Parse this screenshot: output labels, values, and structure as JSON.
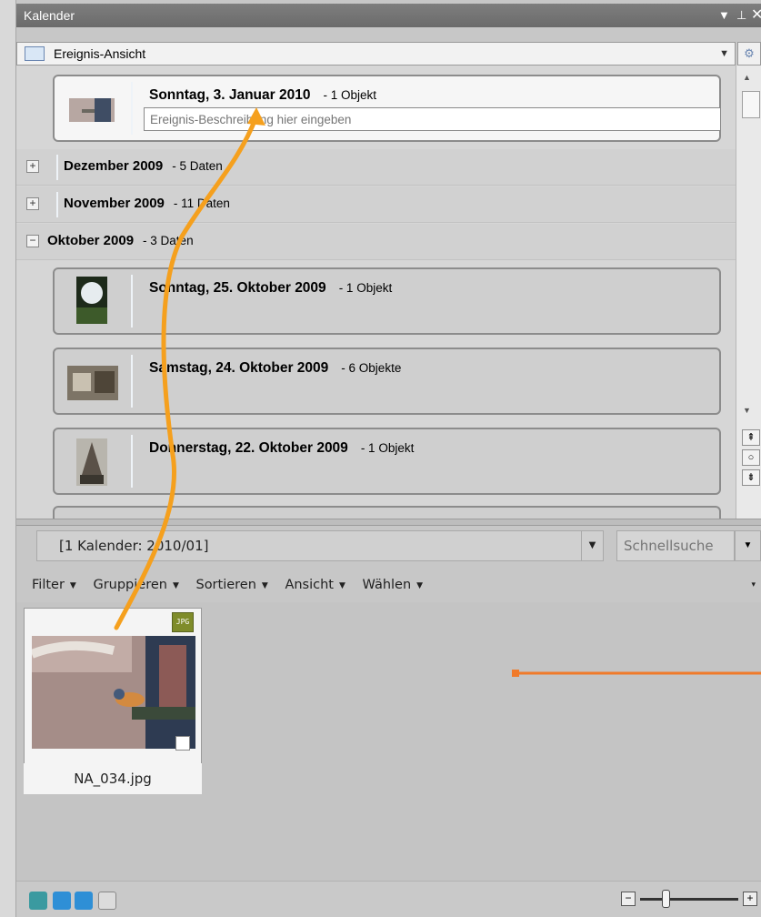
{
  "window": {
    "title": "Kalender"
  },
  "view_selector": {
    "label": "Ereignis-Ansicht"
  },
  "selected_event": {
    "day": "Sonntag, 3. Januar 2010",
    "count": "- 1 Objekt",
    "description_placeholder": "Ereignis-Beschreibung hier eingeben"
  },
  "groups": [
    {
      "month": "Dezember 2009",
      "count": "- 5 Daten",
      "expanded": false
    },
    {
      "month": "November 2009",
      "count": "- 11 Daten",
      "expanded": false
    },
    {
      "month": "Oktober 2009",
      "count": "- 3 Daten",
      "expanded": true
    }
  ],
  "october_events": [
    {
      "day": "Sonntag, 25. Oktober 2009",
      "count": "- 1 Objekt"
    },
    {
      "day": "Samstag, 24. Oktober 2009",
      "count": "- 6 Objekte"
    },
    {
      "day": "Donnerstag, 22. Oktober 2009",
      "count": "- 1 Objekt"
    }
  ],
  "browser": {
    "calendar_filter": "[1 Kalender: 2010/01]",
    "quick_search_placeholder": "Schnellsuche",
    "toolbar": [
      "Filter",
      "Gruppieren",
      "Sortieren",
      "Ansicht",
      "Wählen"
    ],
    "files": [
      {
        "name": "NA_034.jpg",
        "type": "JPG"
      }
    ]
  },
  "colors": {
    "annotation_arrow": "#f5a01e",
    "annotation_line": "#f07a2a",
    "title_bar": "#747474"
  }
}
